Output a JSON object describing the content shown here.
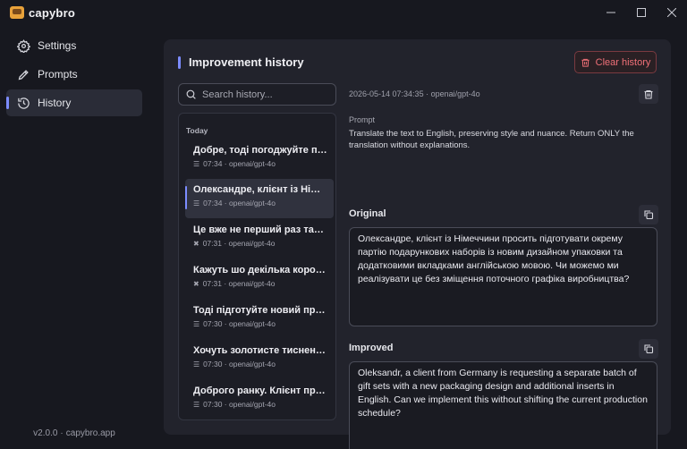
{
  "app": {
    "name": "capybro",
    "version": "v2.0.0",
    "site": "capybro.app"
  },
  "window_controls": {
    "minimize": "—",
    "maximize": "☐",
    "close": "✕"
  },
  "sidebar": {
    "items": [
      {
        "label": "Settings",
        "icon": "gear-icon"
      },
      {
        "label": "Prompts",
        "icon": "pen-icon"
      },
      {
        "label": "History",
        "icon": "history-icon",
        "active": true
      }
    ]
  },
  "panel": {
    "title": "Improvement history",
    "clear_label": "Clear history"
  },
  "search": {
    "placeholder": "Search history..."
  },
  "history": {
    "group": "Today",
    "items": [
      {
        "title": "Добре, тоді погоджуйте пер…",
        "meta": "07:34 · openai/gpt-4o",
        "icon": "list-icon"
      },
      {
        "title": "Олександре, клієнт із Німеч…",
        "meta": "07:34 · openai/gpt-4o",
        "icon": "list-icon",
        "active": true
      },
      {
        "title": "Це вже не перший раз така…",
        "meta": "07:31 · openai/gpt-4o",
        "icon": "x-icon"
      },
      {
        "title": "Кажуть шо декілька коробо…",
        "meta": "07:31 · openai/gpt-4o",
        "icon": "x-icon"
      },
      {
        "title": "Тоді підготуйте новий прора…",
        "meta": "07:30 · openai/gpt-4o",
        "icon": "list-icon"
      },
      {
        "title": "Хочуть золотисте тиснення…",
        "meta": "07:30 · openai/gpt-4o",
        "icon": "list-icon"
      },
      {
        "title": "Доброго ранку. Клієнт прос…",
        "meta": "07:30 · openai/gpt-4o",
        "icon": "list-icon"
      }
    ]
  },
  "detail": {
    "header": "2026-05-14 07:34:35 · openai/gpt-4o",
    "prompt_label": "Prompt",
    "prompt_text": "Translate the text to English, preserving style and nuance. Return ONLY the translation without explanations.",
    "original_label": "Original",
    "original_text": "Олександре, клієнт із Німеччини просить підготувати окрему партію подарункових наборів із новим дизайном упаковки та додатковими вкладками англійською мовою. Чи можемо ми реалізувати це без зміщення поточного графіка виробництва?",
    "improved_label": "Improved",
    "improved_text": "Oleksandr, a client from Germany is requesting a separate batch of gift sets with a new packaging design and additional inserts in English. Can we implement this without shifting the current production schedule?"
  },
  "colors": {
    "accent": "#7c8cff",
    "danger": "#f07078",
    "background": "#17181f",
    "panel": "#22232c"
  }
}
